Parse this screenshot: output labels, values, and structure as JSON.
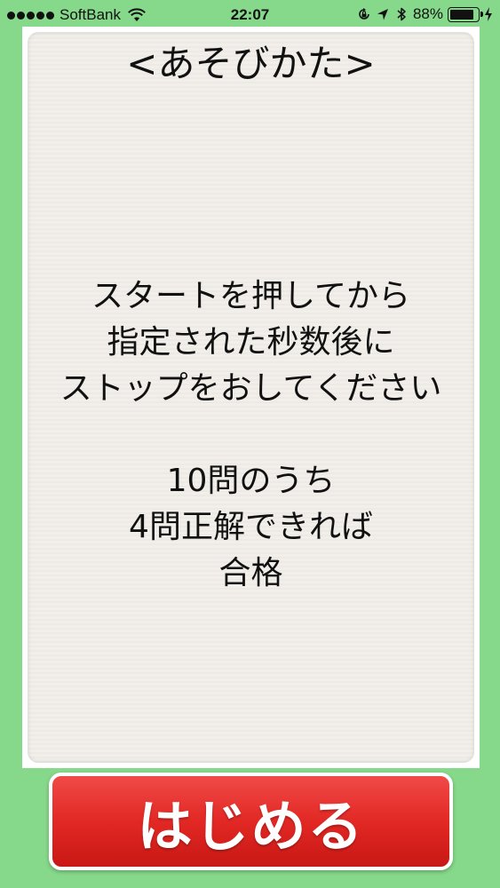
{
  "status_bar": {
    "carrier": "SoftBank",
    "time": "22:07",
    "battery_percent": "88%",
    "battery_level": 0.88,
    "signal_bars": 5,
    "icons": [
      "wifi-icon",
      "orientation-lock-icon",
      "location-arrow-icon",
      "bluetooth-icon",
      "battery-icon",
      "charging-bolt-icon"
    ]
  },
  "board": {
    "title": "<あそびかた>",
    "lines": [
      "スタートを押してから",
      "指定された秒数後に",
      "ストップをおしてください",
      "10問のうち",
      "4問正解できれば",
      "合格"
    ]
  },
  "start_button": {
    "label": "はじめる"
  },
  "colors": {
    "background": "#86d88a",
    "board": "#f2efea",
    "button_red": "#e22824",
    "button_text": "#ffffff"
  }
}
